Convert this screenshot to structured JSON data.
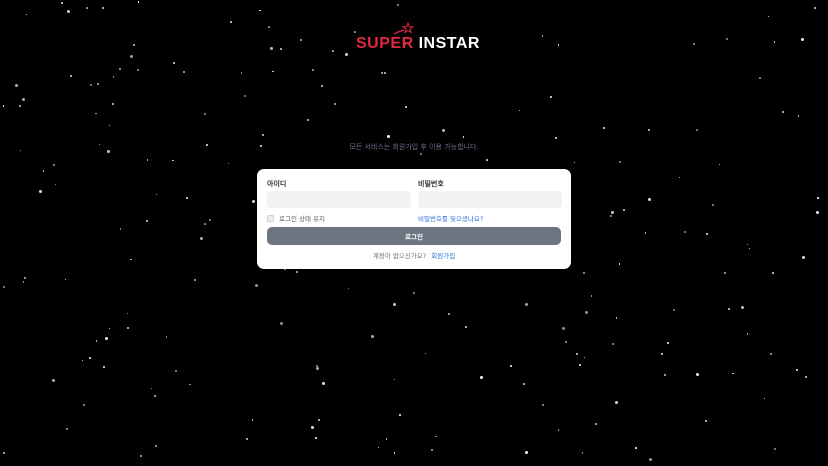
{
  "logo": {
    "part1": "SUPER",
    "part2": "INSTAR",
    "icon": "shooting-star-icon",
    "colors": {
      "red": "#e0293f",
      "white": "#ffffff"
    }
  },
  "notice": "모든 서비스는 회원가입 후 이용 가능합니다.",
  "form": {
    "id_label": "아이디",
    "id_value": "",
    "pw_label": "비밀번호",
    "pw_value": "",
    "remember_label": "로그인 상태 유지",
    "remember_checked": false,
    "forgot_link": "비밀번호를 잊으셨나요?",
    "login_button": "로그인",
    "signup_question": "계정이 없으신가요?",
    "signup_link": "회원가입"
  },
  "colors": {
    "background": "#000000",
    "card": "#ffffff",
    "button": "#6c7682",
    "link": "#2b6fd6",
    "brand_red": "#e0293f"
  }
}
